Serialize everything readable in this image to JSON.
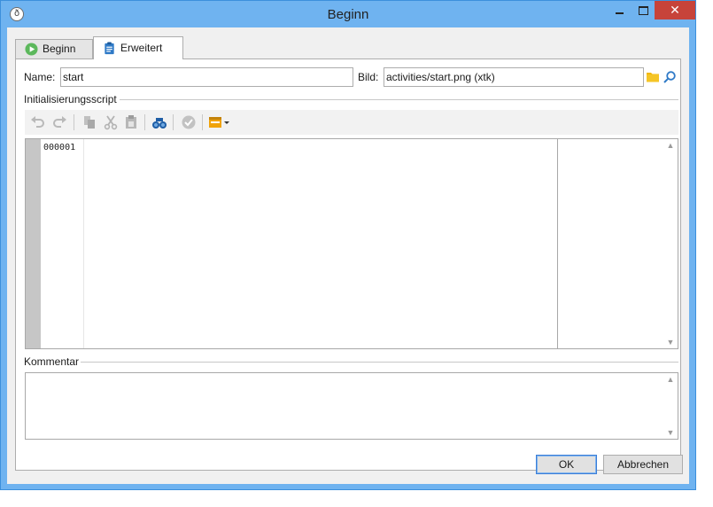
{
  "window": {
    "title": "Beginn"
  },
  "tabs": [
    {
      "label": "Beginn",
      "icon": "play-circle-icon"
    },
    {
      "label": "Erweitert",
      "icon": "clipboard-icon"
    }
  ],
  "form": {
    "name_label": "Name:",
    "name_value": "start",
    "image_label": "Bild:",
    "image_value": "activities/start.png (xtk)"
  },
  "script_section": {
    "label": "Initialisierungsscript",
    "line_numbers": [
      "000001"
    ],
    "toolbar": [
      "undo-icon",
      "redo-icon",
      "copy-icon",
      "cut-icon",
      "paste-icon",
      "binoculars-icon",
      "check-icon",
      "insert-menu-icon"
    ]
  },
  "comment_section": {
    "label": "Kommentar"
  },
  "buttons": {
    "ok": "OK",
    "cancel": "Abbrechen"
  },
  "colors": {
    "titlebar": "#6fb3f0",
    "close": "#c7433a",
    "accent": "#3c7fd8"
  }
}
